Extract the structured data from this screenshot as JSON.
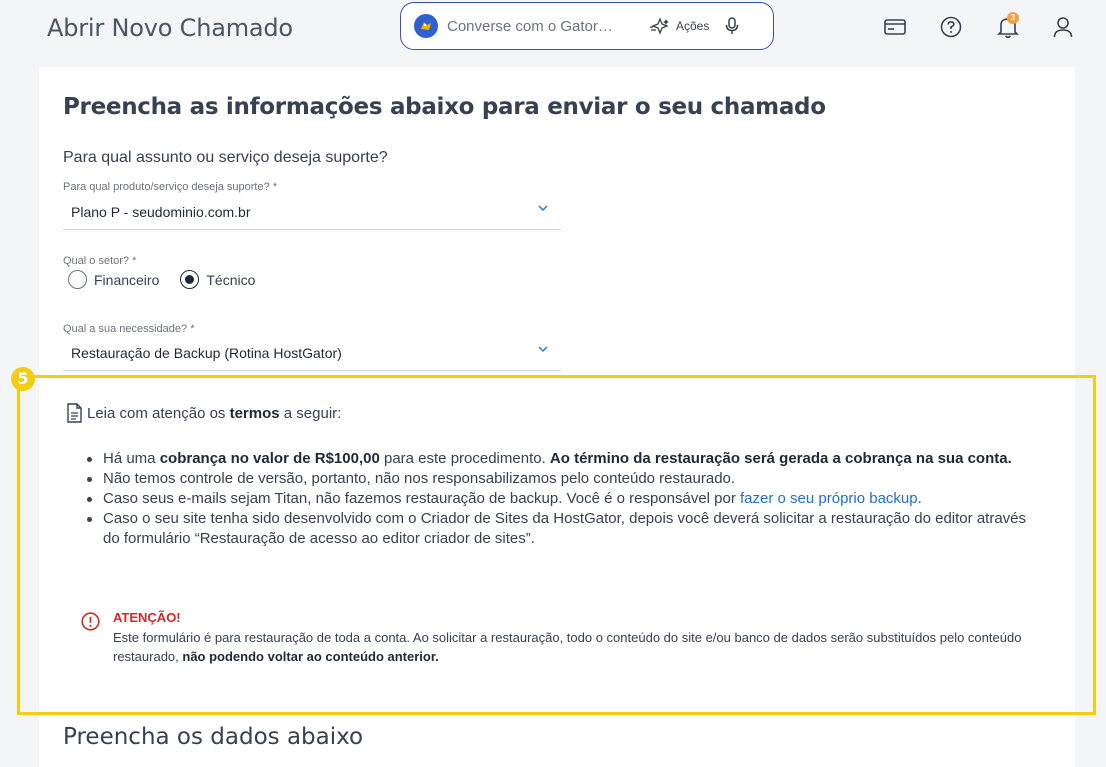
{
  "header": {
    "title": "Abrir Novo Chamado",
    "chat": {
      "placeholder": "Converse com o Gator…",
      "actions_label": "Ações"
    },
    "notification_count": "3",
    "icons": [
      "card-icon",
      "help-icon",
      "bell-icon",
      "user-icon"
    ]
  },
  "form": {
    "title": "Preencha as informações abaixo para enviar o seu chamado",
    "question": "Para qual assunto ou serviço deseja suporte?",
    "product": {
      "label": "Para qual produto/serviço deseja suporte? *",
      "value": "Plano P - seudominio.com.br"
    },
    "sector": {
      "label": "Qual o setor? *",
      "options": [
        "Financeiro",
        "Técnico"
      ],
      "selected": "Técnico"
    },
    "need": {
      "label": "Qual a sua necessidade? *",
      "value": "Restauração de Backup (Rotina HostGator)"
    }
  },
  "step_badge": "5",
  "terms": {
    "intro_before": "Leia com atenção os ",
    "intro_bold": "termos",
    "intro_after": " a seguir:",
    "item1": {
      "t1": "Há uma ",
      "b1": "cobrança no valor de R$100,00",
      "t2": " para este procedimento. ",
      "b2": "Ao término da restauração será gerada a cobrança na sua conta."
    },
    "item2": "Não temos controle de versão, portanto, não nos responsabilizamos pelo conteúdo restaurado.",
    "item3": {
      "text": "Caso seus e-mails sejam Titan, não fazemos restauração de backup. Você é o responsável por ",
      "link": "fazer o seu próprio backup",
      "end": "."
    },
    "item4": "Caso o seu site tenha sido desenvolvido com o Criador de Sites da HostGator, depois você deverá solicitar a restauração do editor através do formulário “Restauração de acesso ao editor criador de sites”."
  },
  "warning": {
    "title": "ATENÇÃO!",
    "text": "Este formulário é para restauração de toda a conta. Ao solicitar a restauração, todo o conteúdo do site e/ou banco de dados serão substituídos pelo conteúdo restaurado,",
    "bold": "não podendo voltar ao conteúdo anterior."
  },
  "section2": {
    "title": "Preencha os dados abaixo"
  },
  "colors": {
    "highlight": "#f2cd16",
    "link": "#1e6fd9",
    "warning": "#dc2626",
    "chat_border": "#3b4fc4"
  }
}
